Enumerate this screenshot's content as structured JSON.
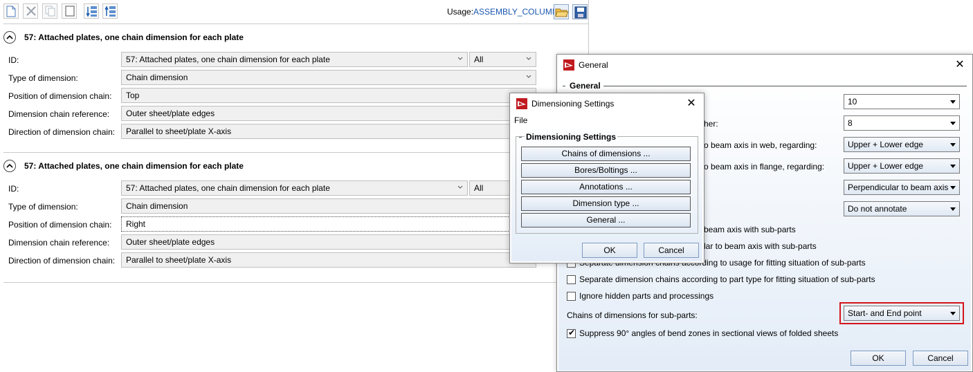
{
  "toolbar": {
    "usage_label": "Usage:",
    "usage_value": "ASSEMBLY_COLUMN"
  },
  "sections": [
    {
      "title": "57: Attached plates, one chain dimension for each plate",
      "rows": [
        {
          "label": "ID:",
          "value": "57: Attached plates, one chain dimension for each plate",
          "extra": "All"
        },
        {
          "label": "Type of dimension:",
          "value": "Chain dimension"
        },
        {
          "label": "Position of dimension chain:",
          "value": "Top"
        },
        {
          "label": "Dimension chain reference:",
          "value": "Outer sheet/plate edges"
        },
        {
          "label": "Direction of dimension chain:",
          "value": "Parallel to sheet/plate X-axis"
        }
      ]
    },
    {
      "title": "57: Attached plates, one chain dimension for each plate",
      "rows": [
        {
          "label": "ID:",
          "value": "57: Attached plates, one chain dimension for each plate",
          "extra": "All"
        },
        {
          "label": "Type of dimension:",
          "value": "Chain dimension"
        },
        {
          "label": "Position of dimension chain:",
          "value": "Right"
        },
        {
          "label": "Dimension chain reference:",
          "value": "Outer sheet/plate edges"
        },
        {
          "label": "Direction of dimension chain:",
          "value": "Parallel to sheet/plate X-axis"
        }
      ]
    }
  ],
  "general_dialog": {
    "title": "General",
    "group_title": "General",
    "rows": [
      {
        "label": "",
        "value": "10"
      },
      {
        "label": "her:",
        "value": "8"
      },
      {
        "label": "o beam axis in web, regarding:",
        "value": "Upper + Lower edge"
      },
      {
        "label": "o beam axis in flange, regarding:",
        "value": "Upper + Lower edge"
      },
      {
        "label": "",
        "value": "Perpendicular to beam axis"
      },
      {
        "label": "",
        "value": "Do not annotate"
      }
    ],
    "partial_checks": [
      "beam axis with sub-parts",
      "lar to beam axis with sub-parts",
      "Separate dimension chains according to usage for fitting situation of sub-parts"
    ],
    "checks": [
      {
        "label": "Separate dimension chains according to part type for fitting situation of sub-parts",
        "checked": false
      },
      {
        "label": "Ignore hidden parts and processings",
        "checked": false
      }
    ],
    "chains_label": "Chains of dimensions for sub-parts:",
    "chains_value": "Start- and End point",
    "suppress_label": "Suppress 90° angles of bend zones in sectional views of folded sheets",
    "suppress_checked": true,
    "ok": "OK",
    "cancel": "Cancel",
    "highlight_color": "#d4141c"
  },
  "dims_dialog": {
    "title": "Dimensioning Settings",
    "menu_file": "File",
    "group_title": "Dimensioning Settings",
    "buttons": [
      "Chains of dimensions ...",
      "Bores/Boltings ...",
      "Annotations ...",
      "Dimension type ...",
      "General ..."
    ],
    "ok": "OK",
    "cancel": "Cancel"
  }
}
